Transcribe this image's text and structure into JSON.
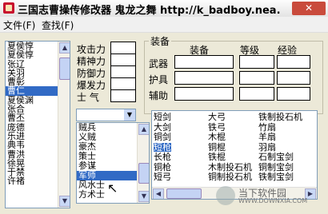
{
  "window": {
    "title": "三国志曹操传修改器 鬼龙之舞 http://k_badboy.nea...",
    "close_glyph": "✕"
  },
  "menu": {
    "file": "文件(F)",
    "search": "查找(F)"
  },
  "characters": [
    "夏侯惇",
    "夏侯惇",
    "张辽",
    "关羽",
    "曹彰",
    "曹仁",
    "夏侯渊",
    "张合",
    "曹丕",
    "庞德",
    "乐进",
    "典韦",
    "曹洪",
    "徐晃",
    "于禁",
    "许褚"
  ],
  "characters_selected_index": 5,
  "stats": {
    "labels": [
      "攻击力",
      "精神力",
      "防御力",
      "爆发力",
      "士 气"
    ]
  },
  "type_select_arrow": "▼",
  "classes": [
    "贼兵",
    "义贼",
    "豪杰",
    "策士",
    "参谋",
    "军师",
    "风水士",
    "方术士"
  ],
  "classes_selected_index": 5,
  "equipment": {
    "title": "装备",
    "col_equip": "装备",
    "col_level": "等级",
    "col_exp": "经验",
    "rows": [
      "武器",
      "护具",
      "辅助"
    ]
  },
  "items": {
    "col1": [
      "短剑",
      "大剑",
      "铜剑",
      "短枪",
      "长枪",
      "铜枪",
      "短弓"
    ],
    "col2": [
      "大弓",
      "铁弓",
      "木棍",
      "铜棍",
      "铁棍",
      "木制投石机",
      "铜制投石机"
    ],
    "col3": [
      "铁制投石机",
      "竹扇",
      "羊扇",
      "羽扇",
      "石制宝剑",
      "铜制宝剑",
      "铁制宝剑"
    ],
    "selected_col1_index": 3
  },
  "watermark": "当下软件园",
  "watermark_url": "WWW.DOWNXIA.COM"
}
